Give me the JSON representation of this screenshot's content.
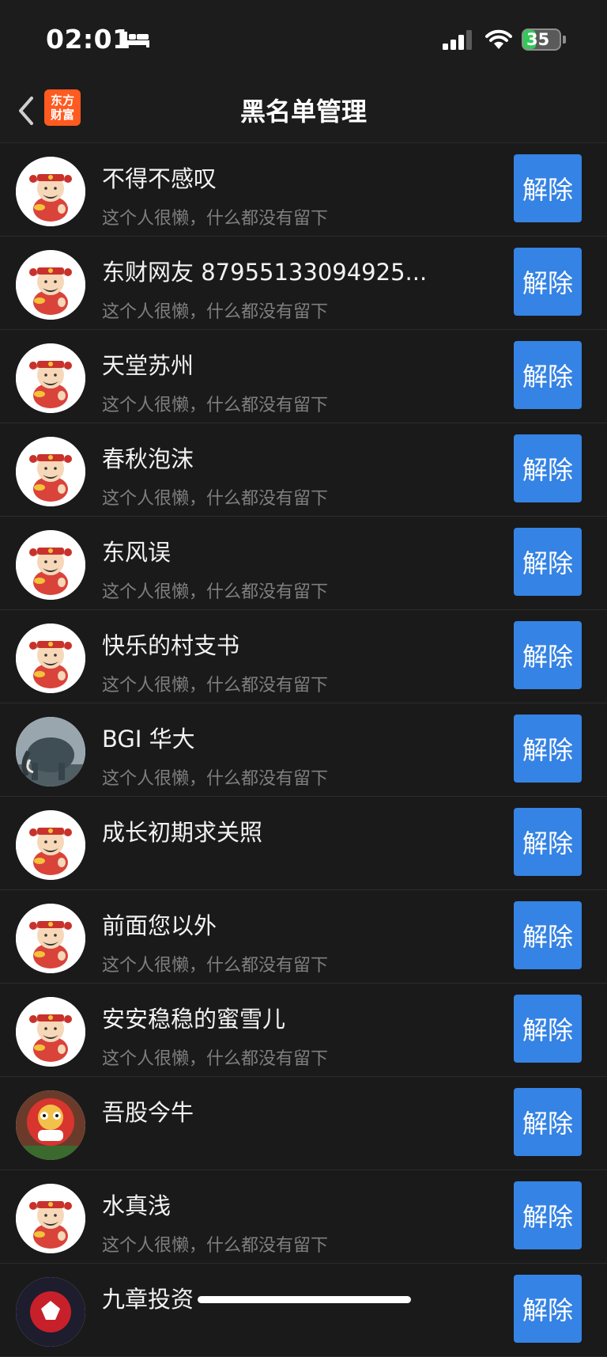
{
  "status": {
    "time": "02:01",
    "battery": "35",
    "battery_level": 0.35
  },
  "nav": {
    "title": "黑名单管理",
    "logo_line1": "东方",
    "logo_line2": "财富"
  },
  "list": {
    "items": [
      {
        "name": "不得不感叹",
        "signature": "这个人很懒，什么都没有留下",
        "action": "解除",
        "avatar": "caishen-avatar"
      },
      {
        "name": "东财网友 87955133094925...",
        "signature": "这个人很懒，什么都没有留下",
        "action": "解除",
        "avatar": "caishen-avatar"
      },
      {
        "name": "天堂苏州",
        "signature": "这个人很懒，什么都没有留下",
        "action": "解除",
        "avatar": "caishen-avatar"
      },
      {
        "name": "春秋泡沫",
        "signature": "这个人很懒，什么都没有留下",
        "action": "解除",
        "avatar": "caishen-avatar"
      },
      {
        "name": "东风误",
        "signature": "这个人很懒，什么都没有留下",
        "action": "解除",
        "avatar": "caishen-avatar"
      },
      {
        "name": "快乐的村支书",
        "signature": "这个人很懒，什么都没有留下",
        "action": "解除",
        "avatar": "caishen-avatar"
      },
      {
        "name": "BGI 华大",
        "signature": "这个人很懒，什么都没有留下",
        "action": "解除",
        "avatar": "mammoth-photo-avatar"
      },
      {
        "name": "成长初期求关照",
        "signature": "",
        "action": "解除",
        "avatar": "caishen-avatar"
      },
      {
        "name": "前面您以外",
        "signature": "这个人很懒，什么都没有留下",
        "action": "解除",
        "avatar": "caishen-avatar"
      },
      {
        "name": "安安稳稳的蜜雪儿",
        "signature": "这个人很懒，什么都没有留下",
        "action": "解除",
        "avatar": "caishen-avatar"
      },
      {
        "name": "吾股今牛",
        "signature": "",
        "action": "解除",
        "avatar": "lion-dance-photo-avatar"
      },
      {
        "name": "水真浅",
        "signature": "这个人很懒，什么都没有留下",
        "action": "解除",
        "avatar": "caishen-avatar"
      },
      {
        "name": "九章投资",
        "signature": "",
        "action": "解除",
        "avatar": "red-logo-avatar"
      }
    ]
  },
  "colors": {
    "background": "#1a1a1a",
    "button": "#3583e4",
    "logo": "#ff5a1f",
    "battery": "#34c759"
  }
}
